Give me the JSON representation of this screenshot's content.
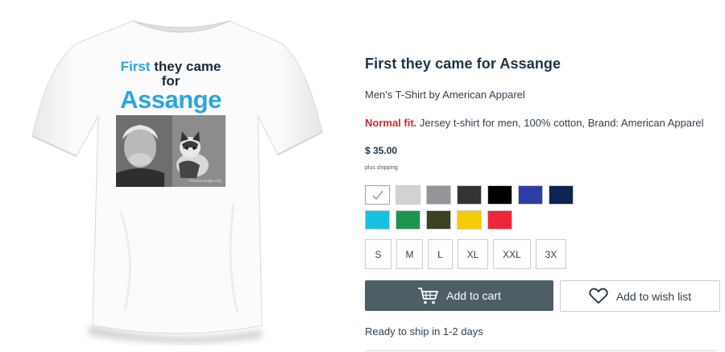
{
  "product": {
    "title": "First they came for Assange",
    "subtitle": "Men's T-Shirt by American Apparel",
    "fit_label": "Normal fit.",
    "fit_description": "Jersey t-shirt for men, 100% cotton, Brand: American Apparel",
    "price": "$ 35.00",
    "shipping_note": "plus shipping",
    "ready_to_ship": "Ready to ship in 1-2 days"
  },
  "print": {
    "line1_accent": "First",
    "line1_rest": " they came for",
    "line2": "Assange",
    "photo_caption": "freeassange.org"
  },
  "colors": [
    {
      "name": "white",
      "hex": "#ffffff",
      "selected": true
    },
    {
      "name": "heather-grey",
      "hex": "#d2d2d2"
    },
    {
      "name": "grey",
      "hex": "#94959a"
    },
    {
      "name": "charcoal",
      "hex": "#333333"
    },
    {
      "name": "black",
      "hex": "#000000"
    },
    {
      "name": "royal-blue",
      "hex": "#2d3ea4"
    },
    {
      "name": "navy",
      "hex": "#0d2452"
    },
    {
      "name": "turquoise",
      "hex": "#17c2e0"
    },
    {
      "name": "kelly-green",
      "hex": "#1d9450"
    },
    {
      "name": "olive",
      "hex": "#3c4220"
    },
    {
      "name": "yellow",
      "hex": "#f6cb06"
    },
    {
      "name": "red",
      "hex": "#ef2637"
    }
  ],
  "sizes": [
    "S",
    "M",
    "L",
    "XL",
    "XXL",
    "3X"
  ],
  "buttons": {
    "add_to_cart": "Add to cart",
    "add_to_wish_list": "Add to wish list"
  },
  "icons": {
    "cart": "cart-icon",
    "heart": "heart-icon",
    "check": "check-icon"
  }
}
